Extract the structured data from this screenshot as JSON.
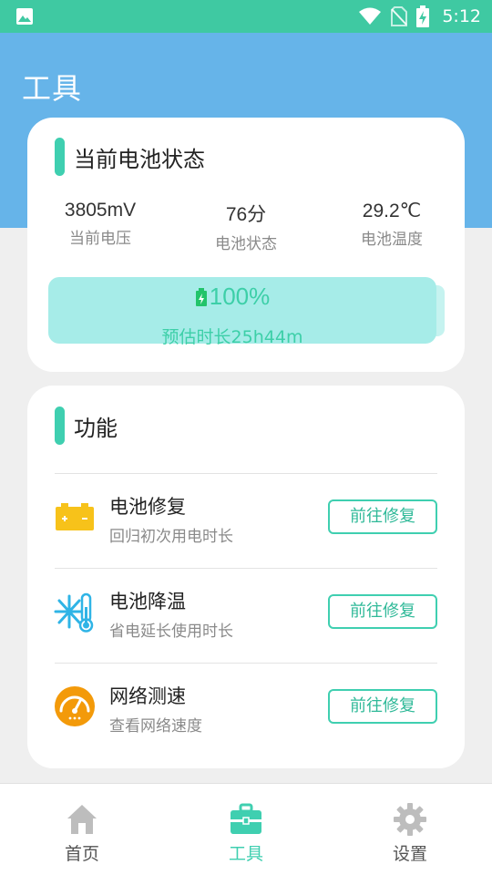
{
  "status_bar": {
    "time": "5:12",
    "icons": [
      "gallery-icon",
      "wifi-icon",
      "no-sim-icon",
      "battery-charging-icon"
    ]
  },
  "header": {
    "title": "工具"
  },
  "battery_card": {
    "title": "当前电池状态",
    "stats": [
      {
        "value": "3805mV",
        "label": "当前电压"
      },
      {
        "value": "76分",
        "label": "电池状态"
      },
      {
        "value": "29.2℃",
        "label": "电池温度"
      }
    ],
    "level": {
      "percent_text": "100%",
      "percent": 100,
      "estimate": "预估时长25h44m"
    }
  },
  "function_card": {
    "title": "功能",
    "items": [
      {
        "name": "电池修复",
        "desc": "回归初次用电时长",
        "button": "前往修复",
        "icon": "battery-repair-icon"
      },
      {
        "name": "电池降温",
        "desc": "省电延长使用时长",
        "button": "前往修复",
        "icon": "snowflake-thermometer-icon"
      },
      {
        "name": "网络测速",
        "desc": "查看网络速度",
        "button": "前往修复",
        "icon": "speedometer-icon"
      }
    ]
  },
  "bottom_nav": {
    "items": [
      {
        "label": "首页",
        "icon": "home-icon",
        "active": false
      },
      {
        "label": "工具",
        "icon": "toolbox-icon",
        "active": true
      },
      {
        "label": "设置",
        "icon": "gear-icon",
        "active": false
      }
    ]
  },
  "colors": {
    "status_bar": "#3fc9a2",
    "header": "#66b4e9",
    "accent": "#3fcfb0",
    "battery_bar": "#a6ece8"
  }
}
